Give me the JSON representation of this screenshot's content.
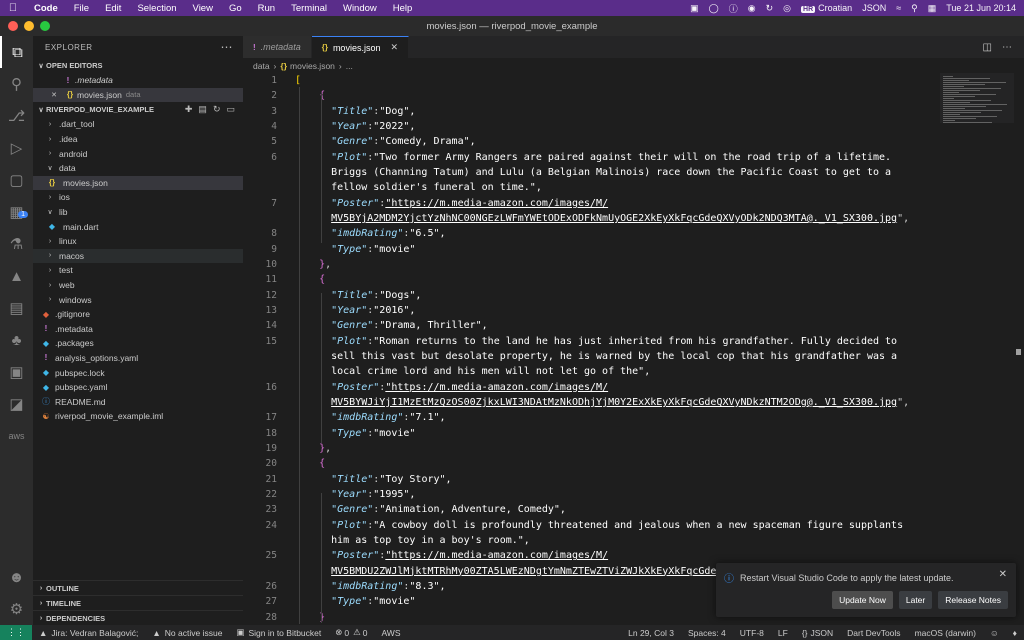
{
  "menubar": {
    "app": "Code",
    "items": [
      "File",
      "Edit",
      "Selection",
      "View",
      "Go",
      "Run",
      "Terminal",
      "Window",
      "Help"
    ],
    "input_badge": "HR",
    "input_source": "Croatian",
    "json_indicator": "JSON",
    "datetime": "Tue 21 Jun  20:14"
  },
  "window": {
    "title": "movies.json — riverpod_movie_example"
  },
  "sidebar": {
    "title": "EXPLORER",
    "open_editors_label": "OPEN EDITORS",
    "open_editors": [
      {
        "name": ".metadata",
        "hint": ""
      },
      {
        "name": "movies.json",
        "hint": "data"
      }
    ],
    "project_label": "RIVERPOD_MOVIE_EXAMPLE",
    "tree": [
      {
        "name": ".dart_tool"
      },
      {
        "name": ".idea"
      },
      {
        "name": "android"
      },
      {
        "name": "data"
      },
      {
        "name": "movies.json"
      },
      {
        "name": "ios"
      },
      {
        "name": "lib"
      },
      {
        "name": "main.dart"
      },
      {
        "name": "linux"
      },
      {
        "name": "macos"
      },
      {
        "name": "test"
      },
      {
        "name": "web"
      },
      {
        "name": "windows"
      },
      {
        "name": ".gitignore"
      },
      {
        "name": ".metadata"
      },
      {
        "name": ".packages"
      },
      {
        "name": "analysis_options.yaml"
      },
      {
        "name": "pubspec.lock"
      },
      {
        "name": "pubspec.yaml"
      },
      {
        "name": "README.md"
      },
      {
        "name": "riverpod_movie_example.iml"
      }
    ],
    "outline_label": "OUTLINE",
    "timeline_label": "TIMELINE",
    "dependencies_label": "DEPENDENCIES"
  },
  "tabs": [
    {
      "label": ".metadata"
    },
    {
      "label": "movies.json"
    }
  ],
  "breadcrumb": {
    "folder": "data",
    "file": "movies.json",
    "more": "..."
  },
  "editor": {
    "line_numbers": [
      "1",
      "2",
      "3",
      "4",
      "5",
      "6",
      "",
      "",
      "7",
      "",
      "8",
      "9",
      "10",
      "11",
      "12",
      "13",
      "14",
      "15",
      "",
      "",
      "16",
      "",
      "17",
      "18",
      "19",
      "20",
      "21",
      "22",
      "23",
      "24",
      "",
      "25",
      "",
      "26",
      "27",
      "28"
    ],
    "lines": [
      "[",
      "    {",
      "      \"Title\":\"Dog\",",
      "      \"Year\":\"2022\",",
      "      \"Genre\":\"Comedy, Drama\",",
      "      \"Plot\":\"Two former Army Rangers are paired against their will on the road trip of a lifetime.",
      "      Briggs (Channing Tatum) and Lulu (a Belgian Malinois) race down the Pacific Coast to get to a",
      "      fellow soldier's funeral on time.\",",
      "      \"Poster\":\"https://m.media-amazon.com/images/M/",
      "      MV5BYjA2MDM2YjctYzNhNC00NGEzLWFmYWEtODExODFkNmUyOGE2XkEyXkFqcGdeQXVyODk2NDQ3MTA@._V1_SX300.jpg\",",
      "      \"imdbRating\":\"6.5\",",
      "      \"Type\":\"movie\"",
      "    },",
      "    {",
      "      \"Title\":\"Dogs\",",
      "      \"Year\":\"2016\",",
      "      \"Genre\":\"Drama, Thriller\",",
      "      \"Plot\":\"Roman returns to the land he has just inherited from his grandfather. Fully decided to",
      "      sell this vast but desolate property, he is warned by the local cop that his grandfather was a",
      "      local crime lord and his men will not let go of the\",",
      "      \"Poster\":\"https://m.media-amazon.com/images/M/",
      "      MV5BYWJiYjI1MzEtMzQzOS00ZjkxLWI3NDAtMzNkODhjYjM0Y2ExXkEyXkFqcGdeQXVyNDkzNTM2ODg@._V1_SX300.jpg\",",
      "      \"imdbRating\":\"7.1\",",
      "      \"Type\":\"movie\"",
      "    },",
      "    {",
      "      \"Title\":\"Toy Story\",",
      "      \"Year\":\"1995\",",
      "      \"Genre\":\"Animation, Adventure, Comedy\",",
      "      \"Plot\":\"A cowboy doll is profoundly threatened and jealous when a new spaceman figure supplants",
      "      him as top toy in a boy's room.\",",
      "      \"Poster\":\"https://m.media-amazon.com/images/M/",
      "      MV5BMDU2ZWJlMjktMTRhMy00ZTA5LWEzNDgtYmNmZTEwZTViZWJkXkEyXkFqcGdeQXVyNDQ2OTk4MzI@._V1_SX300.jpg\",",
      "      \"imdbRating\":\"8.3\",",
      "      \"Type\":\"movie\"",
      "    }"
    ]
  },
  "notification": {
    "message": "Restart Visual Studio Code to apply the latest update.",
    "buttons": [
      "Update Now",
      "Later",
      "Release Notes"
    ]
  },
  "statusbar": {
    "jira": "Jira: Vedran Balagović;",
    "issue": "No active issue",
    "bitbucket": "Sign in to Bitbucket",
    "errors": "0",
    "warnings": "0",
    "aws": "AWS",
    "position": "Ln 29, Col 3",
    "spaces": "Spaces: 4",
    "encoding": "UTF-8",
    "eol": "LF",
    "language": "JSON",
    "devtools": "Dart DevTools",
    "platform": "macOS (darwin)"
  },
  "colors": {
    "menubar": "#5a2d8a",
    "accent": "#3b82f6",
    "json_key": "#9cdcfe",
    "bracket_outer": "#ffd700",
    "bracket_inner": "#da70d6"
  }
}
